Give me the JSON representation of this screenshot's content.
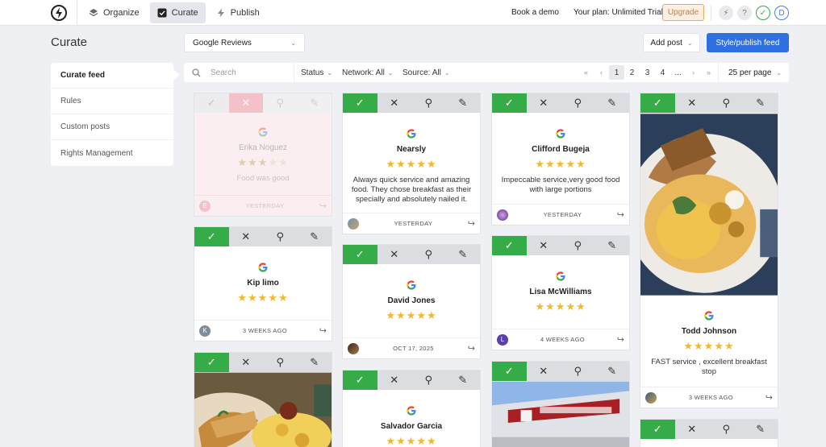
{
  "nav": {
    "organize": "Organize",
    "curate": "Curate",
    "publish": "Publish"
  },
  "top": {
    "book_demo": "Book a demo",
    "plan": "Your plan: Unlimited Trial",
    "upgrade": "Upgrade",
    "help": "?",
    "user_initial": "D"
  },
  "header": {
    "title": "Curate",
    "source": "Google Reviews",
    "add_post": "Add post",
    "publish": "Style/publish feed"
  },
  "menu": [
    "Curate feed",
    "Rules",
    "Custom posts",
    "Rights Management"
  ],
  "filters": {
    "search_placeholder": "Search",
    "status": "Status",
    "network": "Network: All",
    "source": "Source: All",
    "per_page": "25 per page"
  },
  "pager": [
    "1",
    "2",
    "3",
    "4",
    "..."
  ],
  "posts": {
    "c1": {
      "name": "Erika Noguez",
      "stars": 3,
      "text": "Food was good",
      "avatar": "E",
      "date": "YESTERDAY"
    },
    "c2": {
      "name": "Kip limo",
      "stars": 5,
      "text": "",
      "avatar": "K",
      "date": "3 WEEKS AGO"
    },
    "c4": {
      "name": "Nearsly",
      "stars": 5,
      "text": "Always quick service and amazing food. They chose breakfast as their specially and absolutely nailed it.",
      "date": "YESTERDAY"
    },
    "c5": {
      "name": "David Jones",
      "stars": 5,
      "text": "",
      "date": "OCT 17, 2025"
    },
    "c6": {
      "name": "Salvador Garcia",
      "stars": 5
    },
    "c7": {
      "name": "Clifford Bugeja",
      "stars": 5,
      "text": "Impeccable service,very good food with large portions",
      "date": "YESTERDAY"
    },
    "c8": {
      "name": "Lisa McWilliams",
      "stars": 5,
      "text": "",
      "avatar": "L",
      "date": "4 WEEKS AGO"
    },
    "c10": {
      "name": "Todd Johnson",
      "stars": 5,
      "text": "FAST service , excellent breakfast stop",
      "date": "3 WEEKS AGO"
    }
  },
  "colors": {
    "approve": "#35ac48",
    "accent": "#2f6fe0",
    "star": "#f4b82e",
    "upgrade": "#d9782a"
  }
}
